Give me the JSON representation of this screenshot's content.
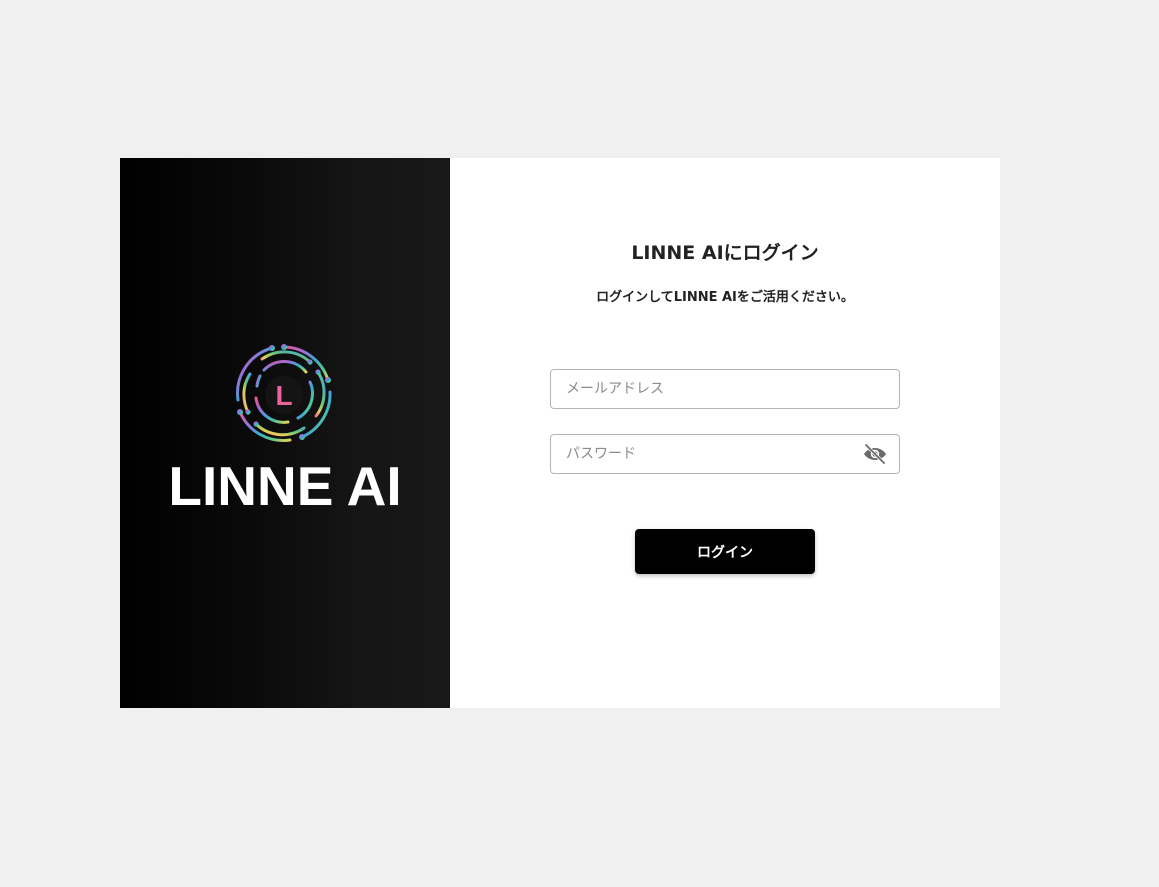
{
  "brand": {
    "logo_icon": "circuit-ring-logo-icon",
    "logo_letter": "L",
    "wordmark": "LINNE AI"
  },
  "login": {
    "title": "LINNE AIにログイン",
    "subtitle": "ログインしてLINNE AIをご活用ください。",
    "email_placeholder": "メールアドレス",
    "email_value": "",
    "password_placeholder": "パスワード",
    "password_value": "",
    "visibility_icon": "eye-off-icon",
    "submit_label": "ログイン"
  },
  "colors": {
    "page_background": "#f0f0f0",
    "brand_panel": "#000000",
    "form_panel": "#ffffff",
    "button": "#000000",
    "logo_letter": "#e8649a"
  }
}
